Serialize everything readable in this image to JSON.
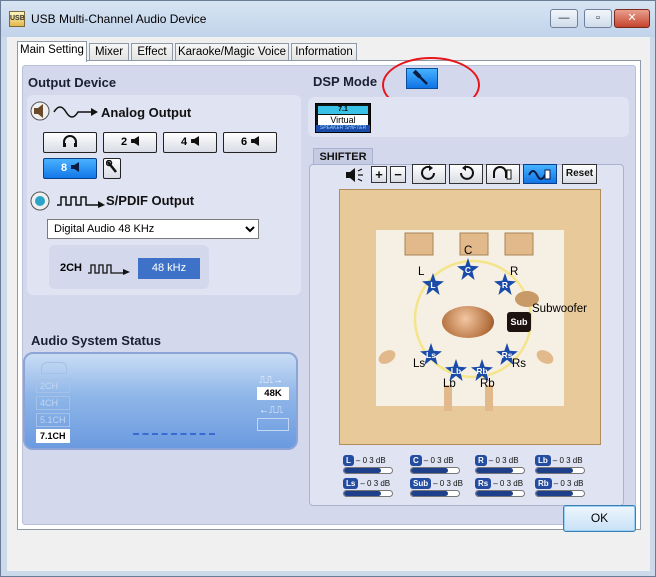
{
  "window": {
    "title": "USB Multi-Channel Audio Device",
    "app_icon_text": "USB",
    "minimize_glyph": "—",
    "maximize_glyph": "▫",
    "close_glyph": "✕"
  },
  "tabs": [
    "Main Setting",
    "Mixer",
    "Effect",
    "Karaoke/Magic Voice",
    "Information"
  ],
  "output_device": {
    "title": "Output Device",
    "analog_label": "Analog Output",
    "channel_buttons": [
      "2",
      "4",
      "6",
      "8"
    ],
    "active_channel": "8",
    "spdif_label": "S/PDIF Output",
    "spdif_select": "Digital Audio 48 KHz",
    "spdif_channels": "2CH",
    "spdif_rate": "48 kHz"
  },
  "audio_status": {
    "title": "Audio System Status",
    "labels": [
      "2CH",
      "4CH",
      "5.1CH",
      "7.1CH"
    ],
    "active_label": "7.1CH",
    "rate": "48K"
  },
  "dsp": {
    "title": "DSP Mode",
    "virtual_top": "7.1",
    "virtual_mid": "Virtual",
    "virtual_bottom": "SPEAKER SHIFTER"
  },
  "shifter": {
    "tab": "SHIFTER",
    "reset_label": "Reset",
    "plus": "+",
    "minus": "−",
    "speaker_labels": {
      "c": "C",
      "l": "L",
      "r": "R",
      "subwoofer": "Subwoofer",
      "ls": "Ls",
      "rs": "Rs",
      "lb": "Lb",
      "rb": "Rb"
    },
    "stars": {
      "c": "C",
      "l": "L",
      "r": "R",
      "sub": "Sub",
      "ls": "Ls",
      "rs": "Rs",
      "lb": "Lb",
      "rb": "Rb"
    },
    "levels": [
      {
        "chip": "L",
        "text": "– 0 3 dB",
        "value": 0.78
      },
      {
        "chip": "C",
        "text": "– 0 3 dB",
        "value": 0.78
      },
      {
        "chip": "R",
        "text": "– 0 3 dB",
        "value": 0.78
      },
      {
        "chip": "Lb",
        "text": "– 0 3 dB",
        "value": 0.78
      },
      {
        "chip": "Ls",
        "text": "– 0 3 dB",
        "value": 0.78
      },
      {
        "chip": "Sub",
        "text": "– 0 3 dB",
        "value": 0.78
      },
      {
        "chip": "Rs",
        "text": "– 0 3 dB",
        "value": 0.78
      },
      {
        "chip": "Rb",
        "text": "– 0 3 dB",
        "value": 0.78
      }
    ]
  },
  "footer": {
    "ok_label": "OK"
  },
  "colors": {
    "accent": "#1277e8",
    "highlight_circle": "#e8161b",
    "panel": "#d3d8ec"
  },
  "icons": [
    "speaker-icon",
    "analog-wave-icon",
    "headphone-icon",
    "wrench-icon",
    "spdif-icon",
    "hammer-icon"
  ]
}
